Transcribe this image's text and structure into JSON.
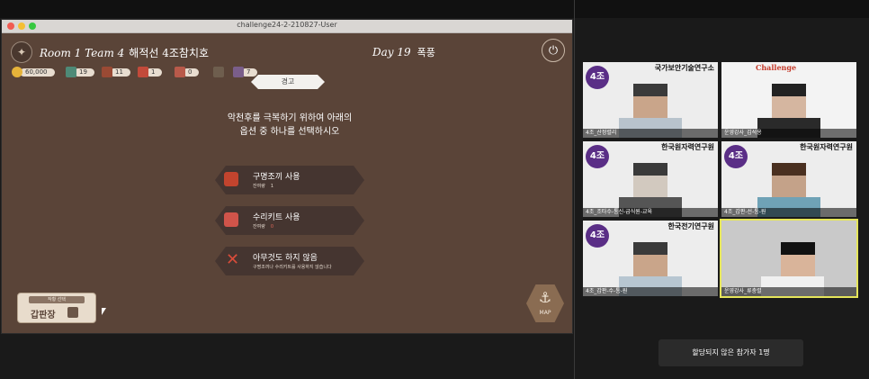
{
  "window": {
    "title": "challenge24-2-210827-User"
  },
  "game": {
    "room": "Room 1 Team 4",
    "ship": "해적선 4조참치호",
    "day": "Day 19",
    "weather": "폭풍",
    "resources": [
      {
        "name": "coin",
        "value": "60,000",
        "color": "#e6b33a"
      },
      {
        "name": "crew",
        "value": "19",
        "color": "#4e8a77"
      },
      {
        "name": "food",
        "value": "11",
        "color": "#9a4a34"
      },
      {
        "name": "ration",
        "value": "1",
        "color": "#c24a3a"
      },
      {
        "name": "repair",
        "value": "0",
        "color": "#b85a4a"
      },
      {
        "name": "barrel",
        "value": "",
        "color": "#6e5e4e"
      },
      {
        "name": "cannon",
        "value": "7",
        "color": "#7a5e8a"
      }
    ],
    "alert_label": "경고",
    "prompt_line1": "악천후를 극복하기 위하여 아래의",
    "prompt_line2": "옵션 중 하나를 선택하시오",
    "options": [
      {
        "label": "구명조끼 사용",
        "sub_label": "잔여량",
        "sub_value": "1"
      },
      {
        "label": "수리키트 사용",
        "sub_label": "잔여량",
        "sub_value": "0"
      },
      {
        "label": "아무것도 하지 않음",
        "sub_label": "구명조끼나 수리키트를 사용하지 않습니다",
        "sub_value": ""
      }
    ],
    "production_caption": "작황 선택",
    "production_name": "갑판장",
    "map_label": "MAP"
  },
  "video": {
    "tiles": [
      {
        "badge": "4조",
        "org": "국가보안기술연구소",
        "name": "4조_산정렬리"
      },
      {
        "badge": "",
        "org": "Challenge",
        "name": "운영강사_김석용"
      },
      {
        "badge": "4조",
        "org": "한국원자력연구원",
        "name": "4조_조타수-통신-급식원-교육"
      },
      {
        "badge": "4조",
        "org": "한국원자력연구원",
        "name": "4조_갑판-선-통-원"
      },
      {
        "badge": "4조",
        "org": "한국전기연구원",
        "name": "4조_갑판-수-통-원"
      },
      {
        "badge": "",
        "org": "",
        "name": "운영강사_류충렬"
      }
    ],
    "toast": "할당되지 않은 참가자 1명"
  }
}
